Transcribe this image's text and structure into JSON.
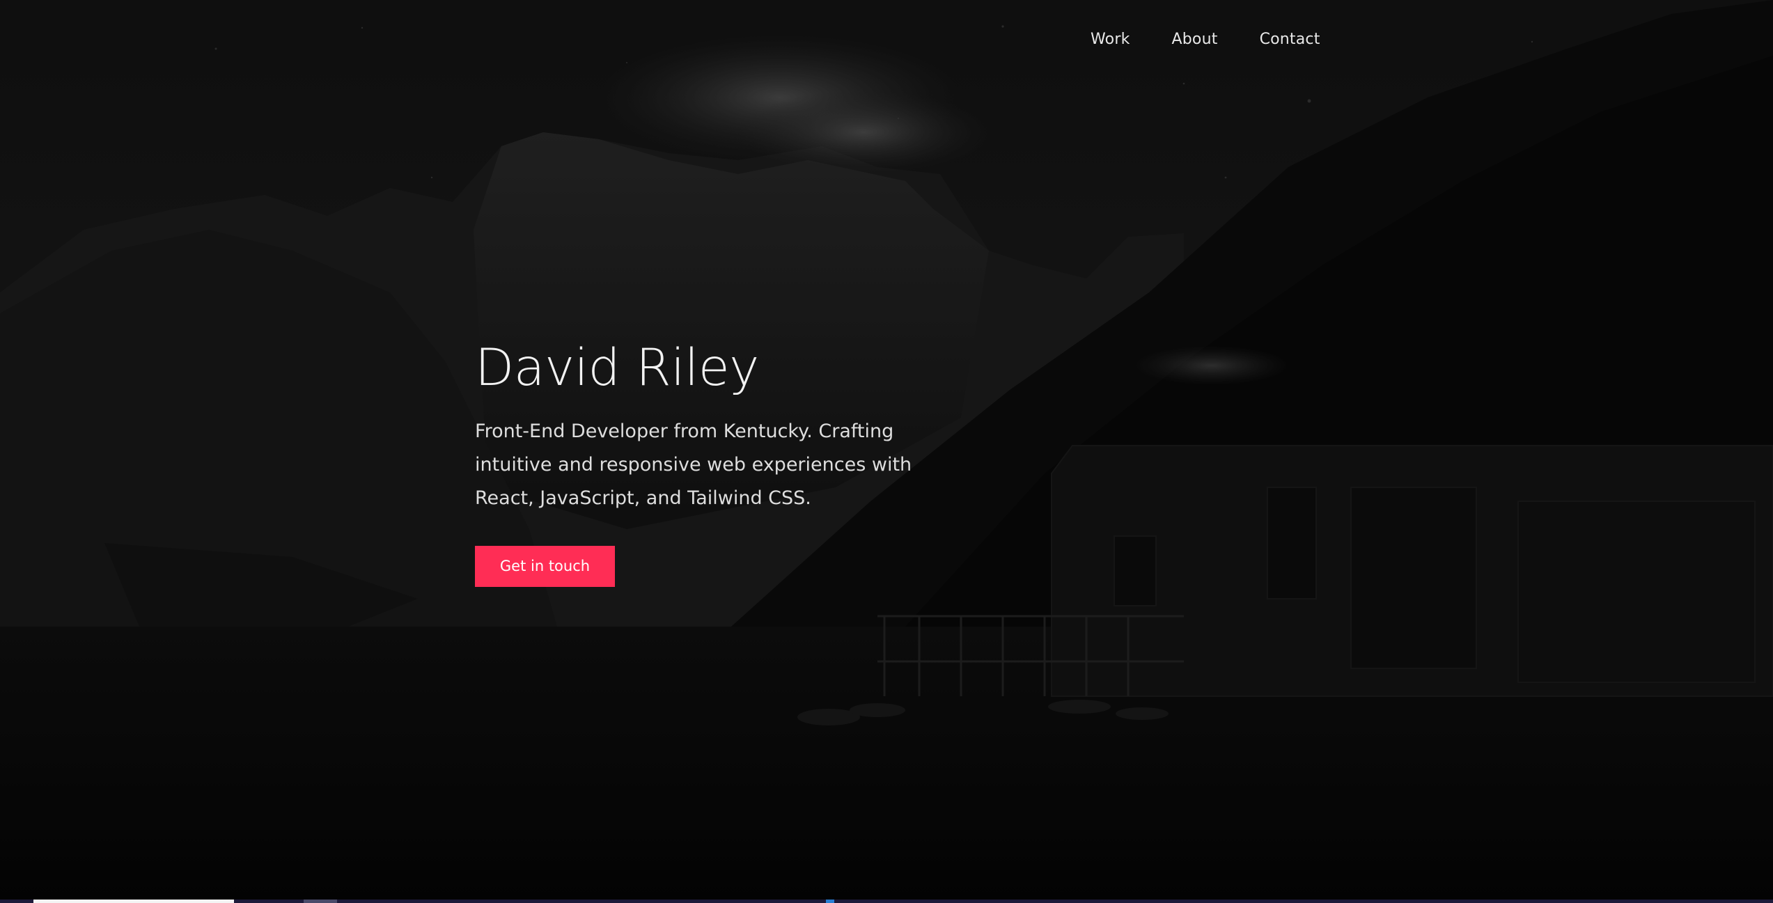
{
  "nav": {
    "items": [
      {
        "label": "Work"
      },
      {
        "label": "About"
      },
      {
        "label": "Contact"
      }
    ]
  },
  "hero": {
    "title": "David Riley",
    "description": "Front-End Developer from Kentucky. Crafting intuitive and responsive web experiences with React, JavaScript, and Tailwind CSS.",
    "cta_label": "Get in touch"
  },
  "colors": {
    "accent": "#ff2d55",
    "background": "#060606",
    "text": "#f2f2f2"
  }
}
